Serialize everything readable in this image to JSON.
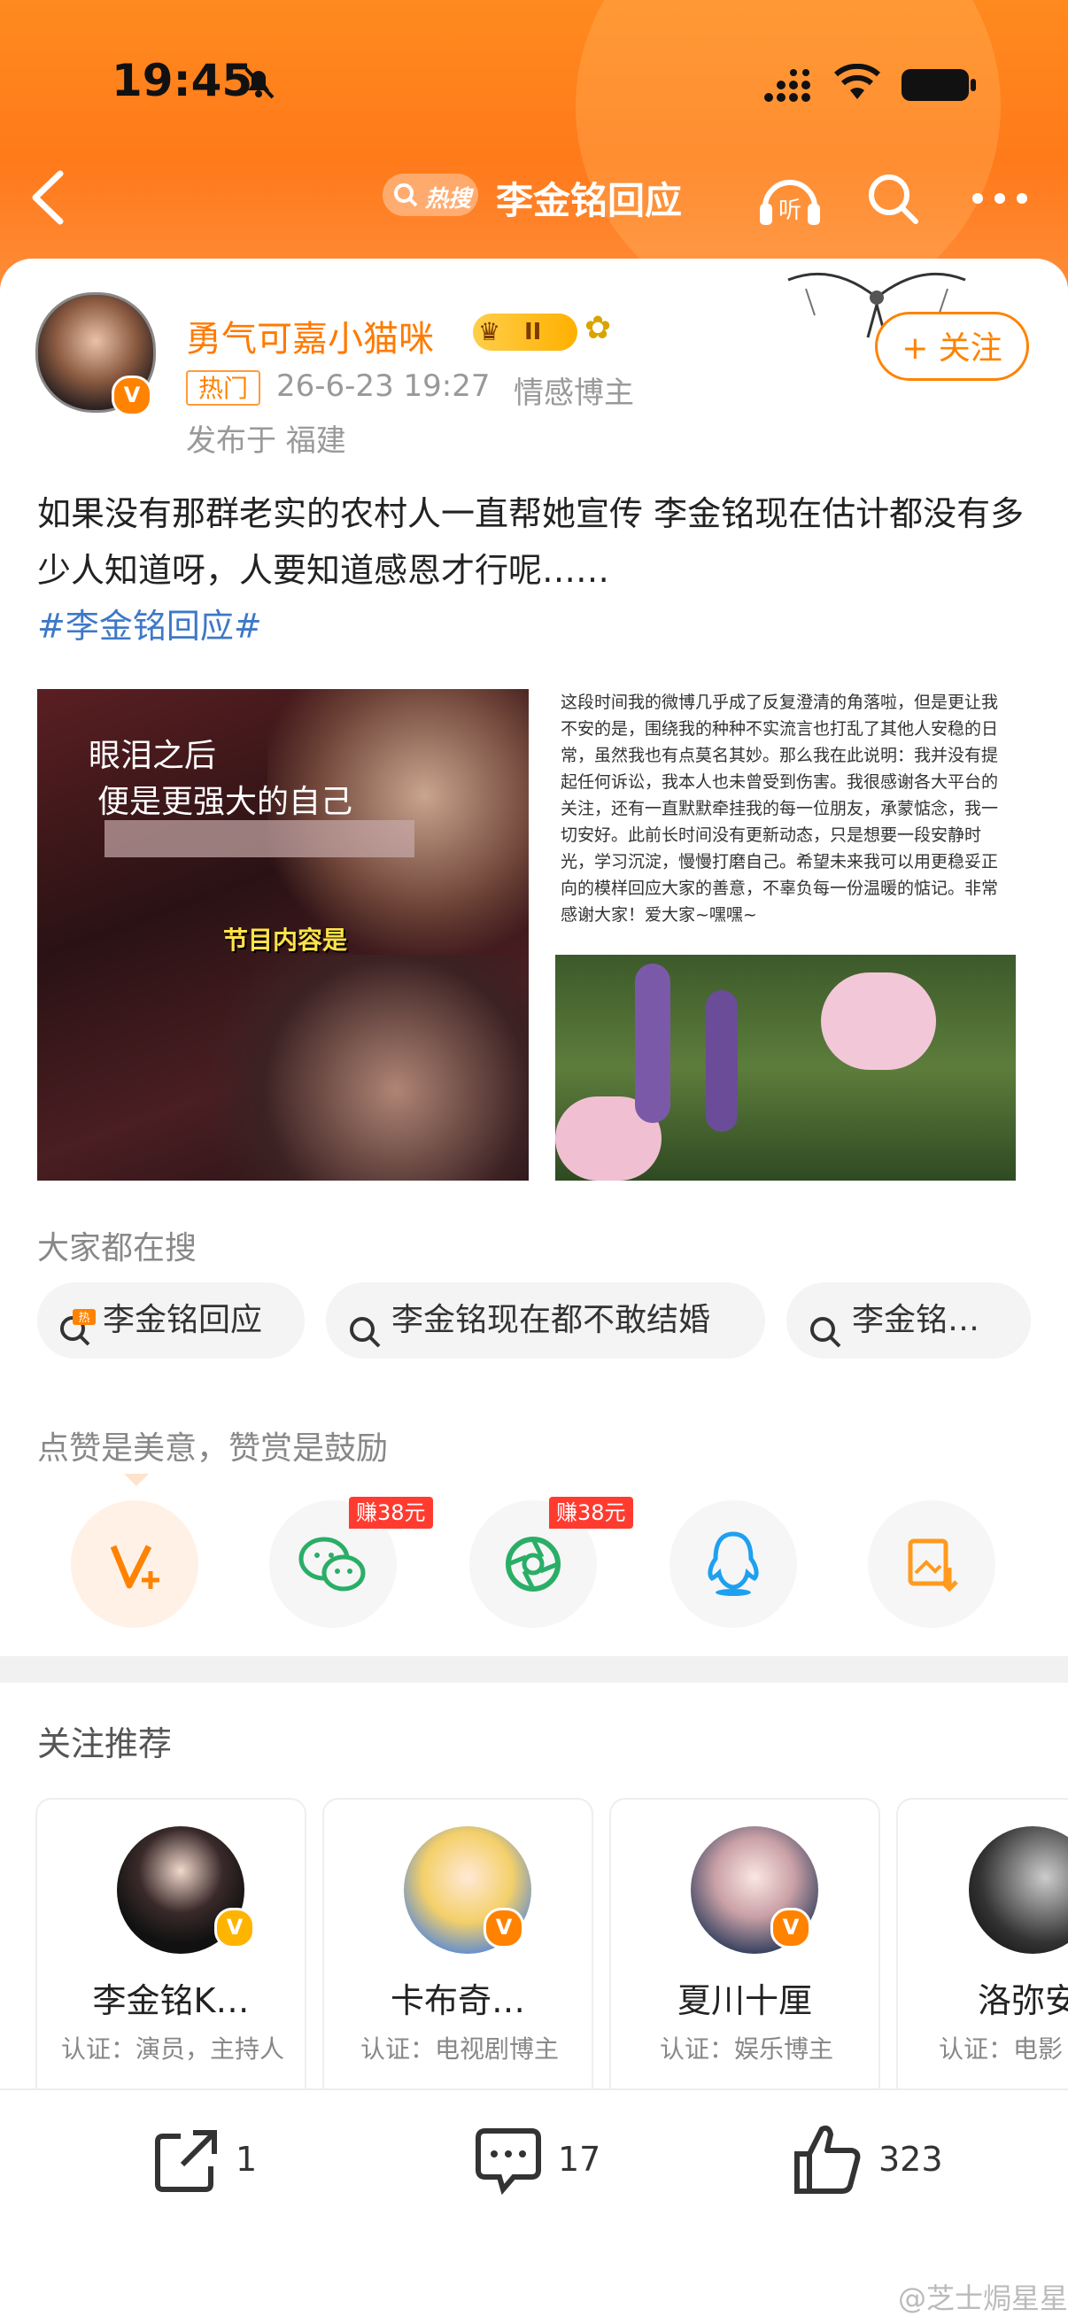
{
  "status": {
    "time": "19:45"
  },
  "nav": {
    "hot_label": "热搜",
    "title": "李金铭回应"
  },
  "post": {
    "author": "勇气可嘉小猫咪",
    "level": "II",
    "tag": "热门",
    "date": "26-6-23 19:27",
    "role": "情感博主",
    "location": "发布于 福建",
    "follow_label": "+ 关注",
    "text": "如果没有那群老实的农村人一直帮她宣传 李金铭现在估计都没有多少人知道呀，人要知道感恩才行呢……",
    "hashtag": "#李金铭回应#",
    "image1_lines": [
      "眼泪之后",
      "便是更强大的自己"
    ],
    "image1_caption": "节目内容是",
    "image2_text": "这段时间我的微博几乎成了反复澄清的角落啦，但是更让我不安的是，围绕我的种种不实流言也打乱了其他人安稳的日常，虽然我也有点莫名其妙。那么我在此说明：我并没有提起任何诉讼，我本人也未曾受到伤害。我很感谢各大平台的关注，还有一直默默牵挂我的每一位朋友，承蒙惦念，我一切安好。此前长时间没有更新动态，只是想要一段安静时光，学习沉淀，慢慢打磨自己。希望未来我可以用更稳妥正向的模样回应大家的善意，不辜负每一份温暖的惦记。非常感谢大家！爱大家~嘿嘿~"
  },
  "search": {
    "label": "大家都在搜",
    "chips": [
      "李金铭回应",
      "李金铭现在都不敢结婚",
      "李金铭…"
    ]
  },
  "share": {
    "label": "点赞是美意，赞赏是鼓励",
    "earn1": "赚38元",
    "earn2": "赚38元"
  },
  "recommend": {
    "label": "关注推荐",
    "items": [
      {
        "name": "李金铭K…",
        "desc": "认证：演员，主持人"
      },
      {
        "name": "卡布奇…",
        "desc": "认证：电视剧博主"
      },
      {
        "name": "夏川十厘",
        "desc": "认证：娱乐博主"
      },
      {
        "name": "洛弥安",
        "desc": "认证：电影"
      }
    ]
  },
  "actions": {
    "reposts": "1",
    "comments": "17",
    "likes": "323"
  },
  "watermark": "@芝士焗星星",
  "colors": {
    "accent": "#ff8200",
    "hashtag": "#3e78c8",
    "earn": "#ff3b30"
  }
}
